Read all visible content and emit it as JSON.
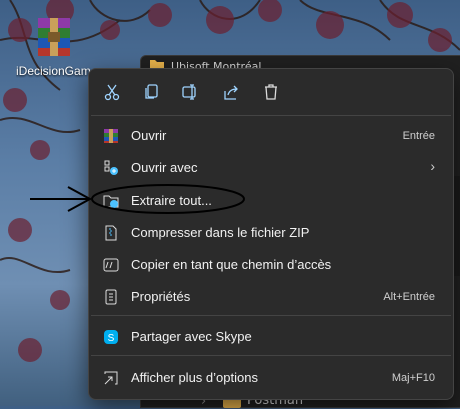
{
  "desktop": {
    "icon_label": "iDecisionGam"
  },
  "explorer": {
    "title": "Ubisoft Montréal",
    "bottom_item": "Postman"
  },
  "toolbar": {
    "buttons": [
      {
        "name": "cut-icon"
      },
      {
        "name": "copy-icon"
      },
      {
        "name": "rename-icon"
      },
      {
        "name": "share-icon"
      },
      {
        "name": "delete-icon"
      }
    ]
  },
  "menu": {
    "items": [
      {
        "label": "Ouvrir",
        "shortcut": "Entrée",
        "icon": "winrar-icon"
      },
      {
        "label": "Ouvrir avec",
        "shortcut": "",
        "icon": "open-with-icon",
        "submenu": true
      },
      {
        "label": "Extraire tout...",
        "shortcut": "",
        "icon": "extract-icon"
      },
      {
        "label": "Compresser dans le fichier ZIP",
        "shortcut": "",
        "icon": "zip-icon"
      },
      {
        "label": "Copier en tant que chemin d’accès",
        "shortcut": "",
        "icon": "copy-path-icon"
      },
      {
        "label": "Propriétés",
        "shortcut": "Alt+Entrée",
        "icon": "properties-icon"
      },
      {
        "label": "Partager avec Skype",
        "shortcut": "",
        "icon": "skype-icon"
      },
      {
        "label": "Afficher plus d’options",
        "shortcut": "Maj+F10",
        "icon": "more-options-icon"
      }
    ],
    "submenu_arrow": "›"
  },
  "colors": {
    "menu_bg": "#2b2b2b",
    "accent": "#4cc2ff",
    "skype": "#00aff0"
  }
}
